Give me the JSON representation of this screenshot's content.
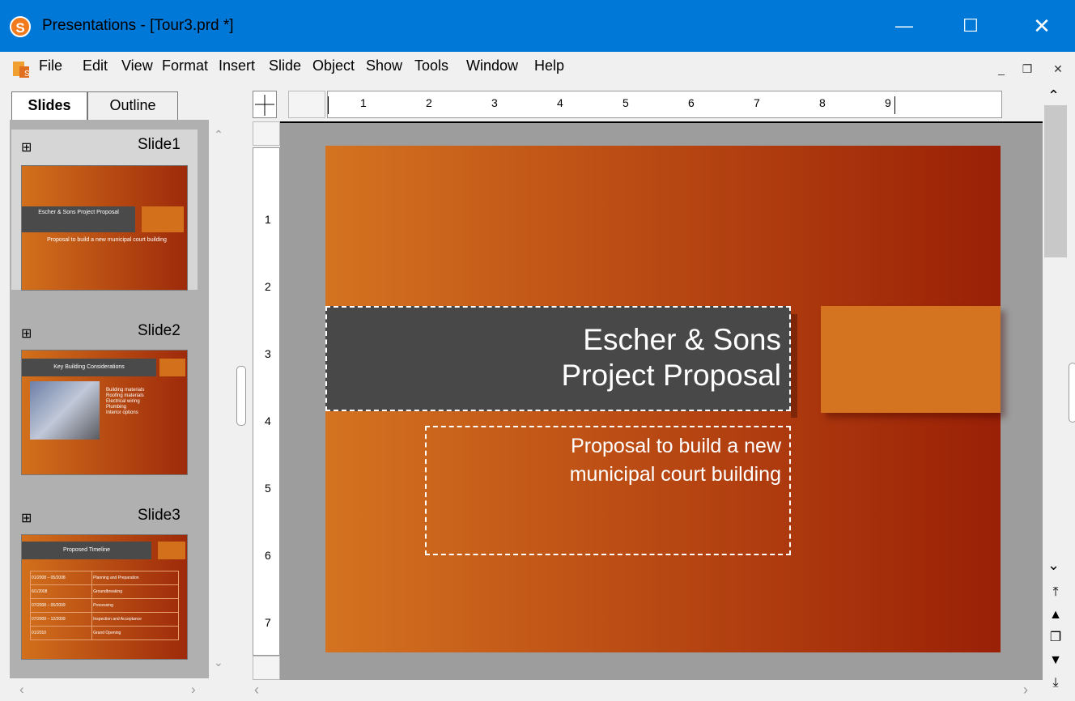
{
  "window": {
    "title": "Presentations - [Tour3.prd *]",
    "logo": "S"
  },
  "menu": [
    "File",
    "Edit",
    "View",
    "Format",
    "Insert",
    "Slide",
    "Object",
    "Show",
    "Tools",
    "Window",
    "Help"
  ],
  "tabs": {
    "slides": "Slides",
    "outline": "Outline"
  },
  "thumbnails": [
    {
      "label": "Slide1",
      "title": "Escher & Sons Project Proposal",
      "subtitle": "Proposal to build a new municipal court building"
    },
    {
      "label": "Slide2",
      "title": "Key Building Considerations",
      "bullets": [
        "Building materials",
        "Roofing materials",
        "Electrical wiring",
        "Plumbing",
        "Interior options"
      ]
    },
    {
      "label": "Slide3",
      "title": "Proposed Timeline",
      "rows": [
        [
          "01/2008 – 05/2008",
          "Planning and Preparation"
        ],
        [
          "6/1/2008",
          "Groundbreaking"
        ],
        [
          "07/2008 – 05/2009",
          "Processing"
        ],
        [
          "07/2009 – 12/2009",
          "Inspection and Acceptance"
        ],
        [
          "01/2010",
          "Grand Opening"
        ]
      ]
    }
  ],
  "hruler_labels": [
    "1",
    "2",
    "3",
    "4",
    "5",
    "6",
    "7",
    "8",
    "9"
  ],
  "vruler_labels": [
    "1",
    "2",
    "3",
    "4",
    "5",
    "6",
    "7"
  ],
  "slide": {
    "title_line1": "Escher & Sons",
    "title_line2": "Project Proposal",
    "subtitle_line1": "Proposal to build a new",
    "subtitle_line2": "municipal court building"
  },
  "colors": {
    "titlebar": "#0078d7",
    "slide_gradient_start": "#d47320",
    "slide_gradient_end": "#9a2006",
    "title_box": "#484848"
  }
}
